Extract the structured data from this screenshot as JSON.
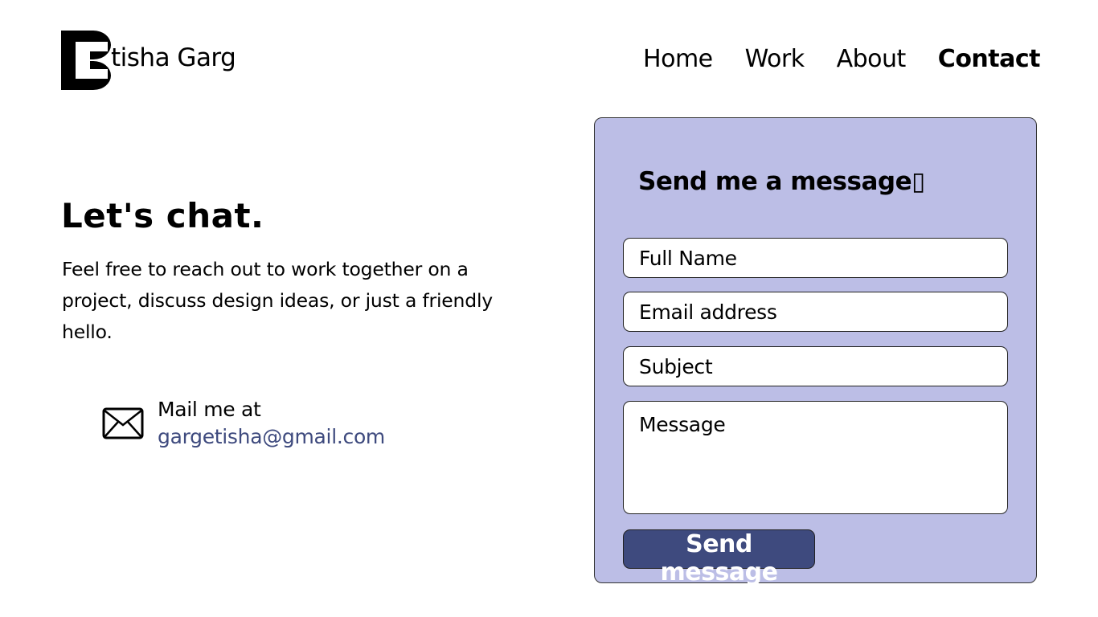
{
  "header": {
    "logo_text": "tisha Garg",
    "nav": [
      {
        "label": "Home"
      },
      {
        "label": "Work"
      },
      {
        "label": "About"
      },
      {
        "label": "Contact"
      }
    ],
    "active_nav": "Contact"
  },
  "intro": {
    "heading": "Let's chat.",
    "body": "Feel free to reach out to work together on a project, discuss design ideas, or just a friendly hello."
  },
  "mail": {
    "icon": "envelope-icon",
    "label": "Mail me at",
    "address": "gargetisha@gmail.com"
  },
  "form": {
    "title": "Send me a message▯",
    "full_name_placeholder": "Full Name",
    "email_placeholder": "Email address",
    "subject_placeholder": "Subject",
    "message_placeholder": "Message",
    "submit_label": "Send message"
  },
  "colors": {
    "card_background": "#bcbee6",
    "button_background": "#3e4a7e",
    "link_color": "#3e4a7e"
  }
}
